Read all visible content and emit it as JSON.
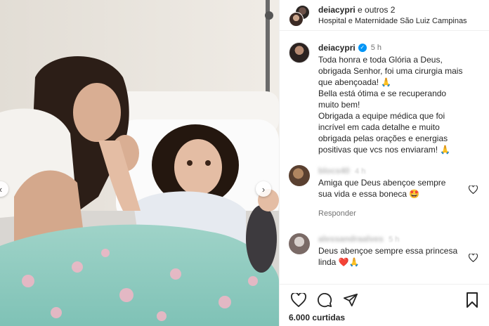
{
  "post": {
    "header": {
      "username": "deiacypri",
      "others": "e outros 2",
      "location": "Hospital e Maternidade São Luiz Campinas"
    },
    "caption": {
      "username": "deiacypri",
      "time": "5 h",
      "lines": [
        "Toda honra e toda Glória a Deus,",
        "obrigada Senhor, foi uma cirurgia mais",
        "que abençoada! 🙏",
        "Bella está ótima e se recuperando",
        "muito bem!",
        "Obrigada a equipe médica que foi",
        "incrível em cada detalhe e muito",
        "obrigada pelas orações e energias",
        "positivas que vcs nos enviaram! 🙏"
      ]
    },
    "comments": [
      {
        "username": "blocs40",
        "time": "4 h",
        "lines": [
          "Amiga que Deus abençoe sempre",
          "sua vida e essa boneca 🤩"
        ],
        "reply_label": "Responder"
      },
      {
        "username": "alessandraalves",
        "time": "5 h",
        "lines": [
          "Deus abençoe sempre essa princesa",
          "linda ❤️🙏"
        ]
      }
    ],
    "likes": {
      "count": "6.000",
      "label": "curtidas"
    }
  },
  "icons": {
    "carousel_prev": "chevron-left-icon",
    "carousel_next": "chevron-right-icon",
    "like": "heart-icon",
    "comment": "comment-icon",
    "share": "paper-plane-icon",
    "save": "bookmark-icon",
    "verified": "verified-badge-icon"
  },
  "colors": {
    "accent": "#0095f6",
    "text": "#262626",
    "muted": "#737373",
    "divider": "#efefef"
  }
}
